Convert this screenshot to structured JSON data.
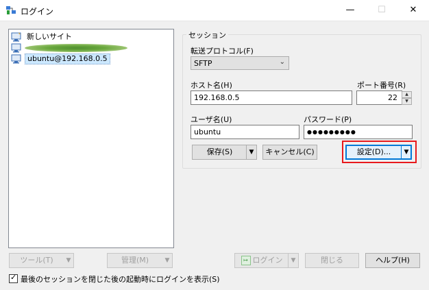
{
  "window": {
    "title": "ログイン",
    "minimize": "—",
    "maximize": "☐",
    "close": "✕"
  },
  "site_list": {
    "items": [
      {
        "label": "新しいサイト",
        "icon": "new-site-icon",
        "selected": false
      },
      {
        "label": "",
        "icon": "computer-icon",
        "selected": false,
        "obscured": true
      },
      {
        "label": "ubuntu@192.168.0.5",
        "icon": "computer-icon",
        "selected": true
      }
    ]
  },
  "session": {
    "group_title": "セッション",
    "protocol_label": "転送プロトコル(F)",
    "protocol_value": "SFTP",
    "host_label": "ホスト名(H)",
    "host_value": "192.168.0.5",
    "port_label": "ポート番号(R)",
    "port_value": "22",
    "user_label": "ユーザ名(U)",
    "user_value": "ubuntu",
    "password_label": "パスワード(P)",
    "password_value": "●●●●●●●●●",
    "save_button": "保存(S)",
    "cancel_button": "キャンセル(C)",
    "settings_button": "設定(D)..."
  },
  "bottom": {
    "tools_button": "ツール(T)",
    "manage_button": "管理(M)",
    "login_button": "ログイン",
    "close_button": "閉じる",
    "help_button": "ヘルプ(H)",
    "show_login_checkbox": "最後のセッションを閉じた後の起動時にログインを表示(S)",
    "show_login_checked": true
  },
  "colors": {
    "highlight": "#e8191c",
    "default_button_border": "#0078d7",
    "selected_item_bg": "#cce8ff"
  }
}
